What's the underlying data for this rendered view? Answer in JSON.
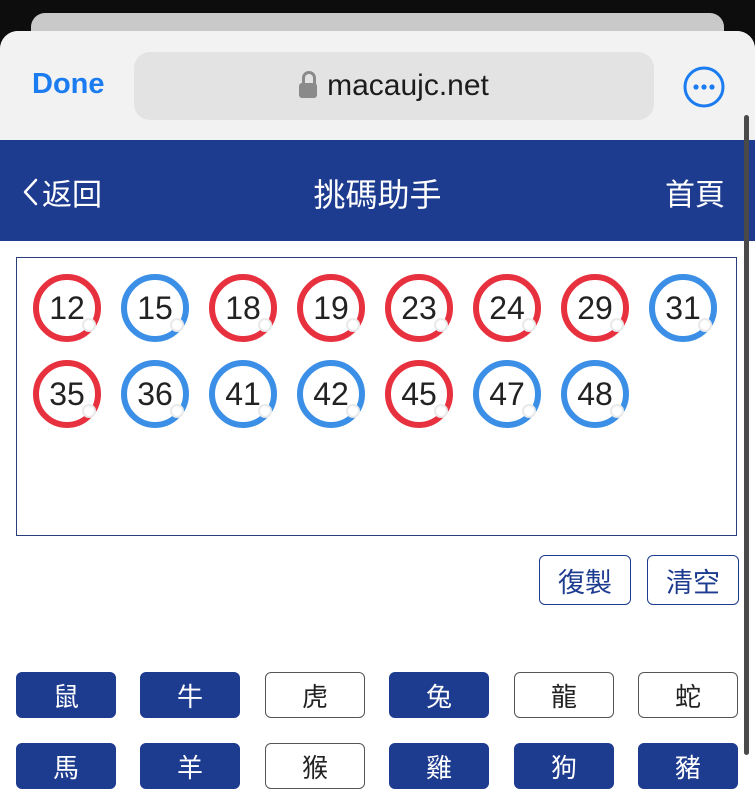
{
  "browser": {
    "done_label": "Done",
    "url": "macaujc.net",
    "accent_color": "#1a7cf0"
  },
  "header": {
    "back_label": "返回",
    "title": "挑碼助手",
    "home_label": "首頁",
    "bg_color": "#1d3b8f"
  },
  "numbers": [
    {
      "value": "12",
      "color": "red"
    },
    {
      "value": "15",
      "color": "blue"
    },
    {
      "value": "18",
      "color": "red"
    },
    {
      "value": "19",
      "color": "red"
    },
    {
      "value": "23",
      "color": "red"
    },
    {
      "value": "24",
      "color": "red"
    },
    {
      "value": "29",
      "color": "red"
    },
    {
      "value": "31",
      "color": "blue"
    },
    {
      "value": "35",
      "color": "red"
    },
    {
      "value": "36",
      "color": "blue"
    },
    {
      "value": "41",
      "color": "blue"
    },
    {
      "value": "42",
      "color": "blue"
    },
    {
      "value": "45",
      "color": "red"
    },
    {
      "value": "47",
      "color": "blue"
    },
    {
      "value": "48",
      "color": "blue"
    }
  ],
  "actions": {
    "copy_label": "復製",
    "clear_label": "清空"
  },
  "zodiac": [
    {
      "label": "鼠",
      "selected": true
    },
    {
      "label": "牛",
      "selected": true
    },
    {
      "label": "虎",
      "selected": false
    },
    {
      "label": "兔",
      "selected": true
    },
    {
      "label": "龍",
      "selected": false
    },
    {
      "label": "蛇",
      "selected": false
    },
    {
      "label": "馬",
      "selected": true
    },
    {
      "label": "羊",
      "selected": true
    },
    {
      "label": "猴",
      "selected": false
    },
    {
      "label": "雞",
      "selected": true
    },
    {
      "label": "狗",
      "selected": true
    },
    {
      "label": "豬",
      "selected": true
    }
  ]
}
